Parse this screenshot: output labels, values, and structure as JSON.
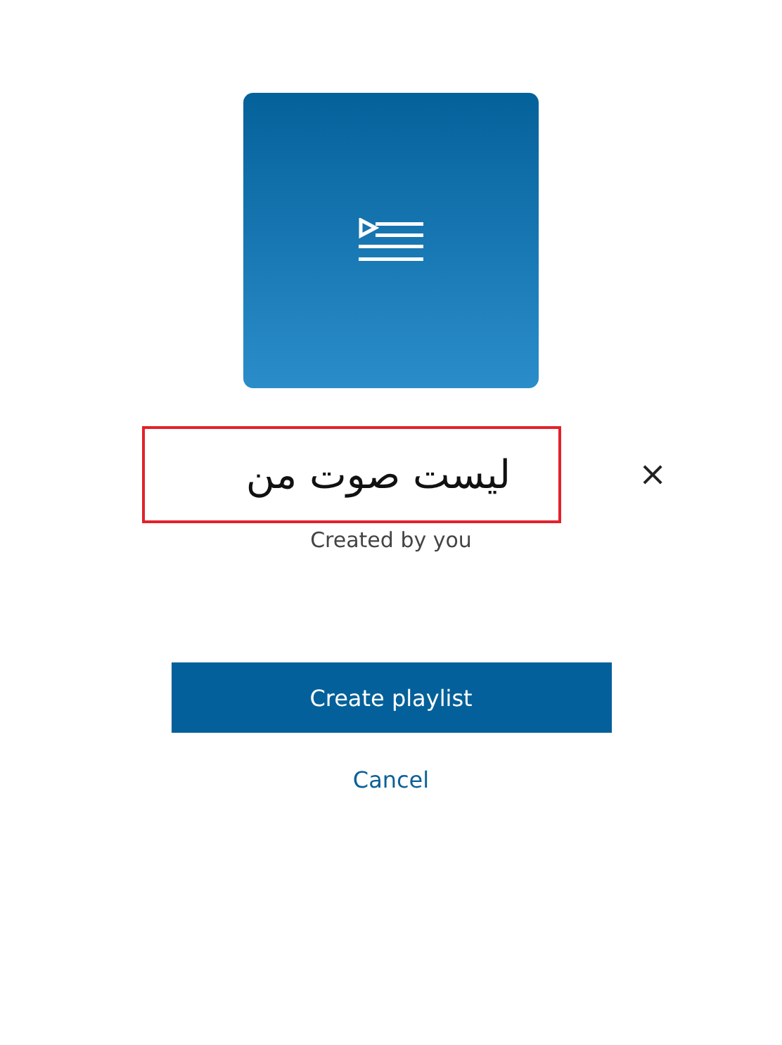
{
  "playlist_name_field": {
    "value": "لیست صوت من"
  },
  "clear_button": {
    "label": "×"
  },
  "subtitle": "Created by you",
  "create_button": {
    "label": "Create playlist"
  },
  "cancel_link": {
    "label": "Cancel"
  }
}
